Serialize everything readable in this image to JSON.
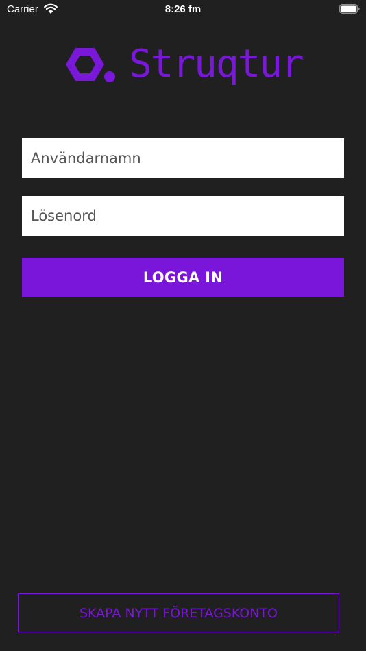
{
  "status_bar": {
    "carrier": "Carrier",
    "time": "8:26 fm",
    "wifi_icon": "wifi-icon",
    "battery_icon": "battery-icon"
  },
  "logo": {
    "text": "Struqtur",
    "mark_icon": "hexagon-logo-icon",
    "color": "#7a18d9"
  },
  "login_form": {
    "username_placeholder": "Användarnamn",
    "password_placeholder": "Lösenord",
    "login_button_label": "LOGGA IN"
  },
  "footer": {
    "create_account_label": "SKAPA NYTT FÖRETAGSKONTO"
  },
  "colors": {
    "background": "#202020",
    "accent": "#7a16d9",
    "field_background": "#ffffff"
  }
}
